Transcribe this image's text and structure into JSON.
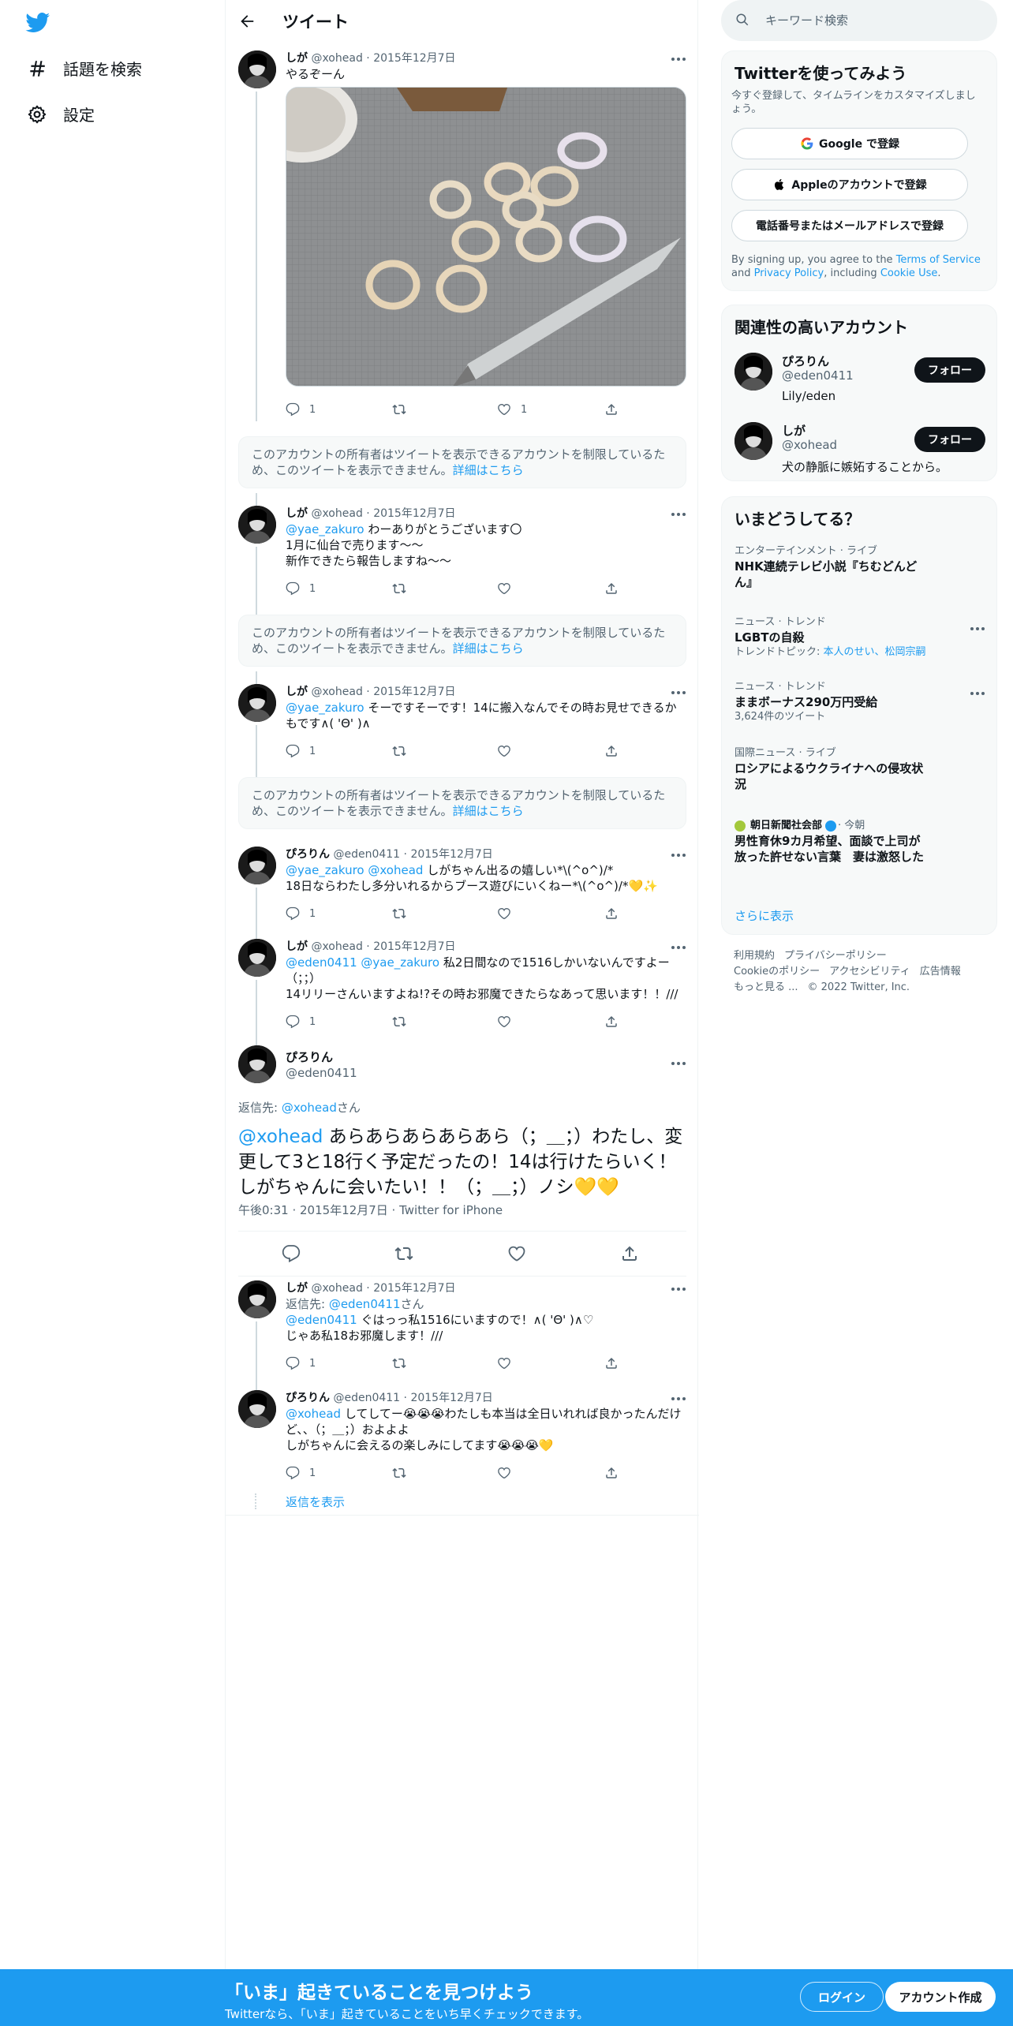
{
  "nav": {
    "search_label": "話題を検索",
    "settings_label": "設定"
  },
  "header": {
    "title": "ツイート"
  },
  "tweets": [
    {
      "name": "しが",
      "handle": "@xohead",
      "date": "2015年12月7日",
      "text": "やるぞーん",
      "replies": "1",
      "retweets": "",
      "likes": "1"
    },
    {
      "name": "しが",
      "handle": "@xohead",
      "date": "2015年12月7日",
      "mention": "@yae_zakuro",
      "text": " わーありがとうございます〇\n1月に仙台で売ります〜〜\n新作できたら報告しますね〜〜",
      "replies": "1",
      "retweets": "",
      "likes": ""
    },
    {
      "name": "しが",
      "handle": "@xohead",
      "date": "2015年12月7日",
      "mention": "@yae_zakuro",
      "text": " そーですそーです！14に搬入なんでその時お見せできるかもです∧( 'Θ' )∧",
      "replies": "1",
      "retweets": "",
      "likes": ""
    },
    {
      "name": "ぴろりん",
      "handle": "@eden0411",
      "date": "2015年12月7日",
      "mention": "@yae_zakuro @xohead",
      "text": " しがちゃん出るの嬉しい*\\(^o^)/*\n18日ならわたし多分いれるからブース遊びにいくねー*\\(^o^)/*💛✨",
      "replies": "1",
      "retweets": "",
      "likes": ""
    },
    {
      "name": "しが",
      "handle": "@xohead",
      "date": "2015年12月7日",
      "mention": "@eden0411 @yae_zakuro",
      "text": " 私2日間なので1516しかいないんですよー（；；）\n14リリーさんいますよね!?その時お邪魔できたらなあって思います！！///",
      "replies": "1",
      "retweets": "",
      "likes": ""
    },
    {
      "name": "しが",
      "handle": "@xohead",
      "date": "2015年12月7日",
      "reply_prefix": "返信先: ",
      "reply_to": "@eden0411",
      "reply_suffix": "さん",
      "mention": "@eden0411",
      "text": " ぐはっっ私1516にいますので！∧( 'Θ' )∧♡\nじゃあ私18お邪魔します！///",
      "replies": "1",
      "retweets": "",
      "likes": ""
    },
    {
      "name": "ぴろりん",
      "handle": "@eden0411",
      "date": "2015年12月7日",
      "mention": "@xohead",
      "text": " してしてー😭😭😭わたしも本当は全日いれれば良かったんだけど、、（；＿；）およよよ\nしがちゃんに会えるの楽しみにしてます😭😭😭💛",
      "replies": "1",
      "retweets": "",
      "likes": ""
    }
  ],
  "restricted": {
    "text": "このアカウントの所有者はツイートを表示できるアカウントを制限しているため、このツイートを表示できません。",
    "link": "詳細はこちら"
  },
  "main_tweet": {
    "name": "ぴろりん",
    "handle": "@eden0411",
    "reply_prefix": "返信先: ",
    "reply_to": "@xohead",
    "reply_suffix": "さん",
    "mention": "@xohead",
    "text": " あらあらあらあらあら（；＿；）わたし、変更して3と18行く予定だったの！14は行けたらいく！しがちゃんに会いたい！！（；＿；）ノシ💛💛",
    "timestamp": "午後0:31 · 2015年12月7日 · Twitter for iPhone"
  },
  "show_replies": "返信を表示",
  "search": {
    "placeholder": "キーワード検索"
  },
  "signup_card": {
    "title": "Twitterを使ってみよう",
    "subtitle": "今すぐ登録して、タイムラインをカスタマイズしましょう。",
    "google": "Google で登録",
    "apple": "Appleのアカウントで登録",
    "phone": "電話番号またはメールアドレスで登録",
    "legal_prefix": "By signing up, you agree to the ",
    "terms": "Terms of Service",
    "and": " and ",
    "privacy": "Privacy Policy",
    "including": ", including ",
    "cookie": "Cookie Use",
    "period": "."
  },
  "relevant": {
    "title": "関連性の高いアカウント",
    "follow_label": "フォロー",
    "accounts": [
      {
        "name": "ぴろりん",
        "handle": "@eden0411",
        "bio": "Lily/eden"
      },
      {
        "name": "しが",
        "handle": "@xohead",
        "bio": "犬の静脈に嫉妬することから。"
      }
    ]
  },
  "trends": {
    "title": "いまどうしてる？",
    "items": [
      {
        "category": "エンターテインメント · ライブ",
        "title": "NHK連続テレビ小説『ちむどんどん』"
      },
      {
        "category": "ニュース · トレンド",
        "title": "LGBTの自殺",
        "topic_prefix": "トレンドトピック: ",
        "topic_links": "本人のせい、松岡宗嗣"
      },
      {
        "category": "ニュース · トレンド",
        "title": "ままボーナス290万円受給",
        "count": "3,624件のツイート"
      },
      {
        "category": "国際ニュース · ライブ",
        "title": "ロシアによるウクライナへの侵攻状況"
      },
      {
        "source": "朝日新聞社会部",
        "time": " · 今朝",
        "title": "男性育休9カ月希望、面談で上司が放った許せない言葉　妻は激怒した"
      }
    ],
    "more": "さらに表示"
  },
  "footer": {
    "terms": "利用規約",
    "privacy": "プライバシーポリシー",
    "cookie": "Cookieのポリシー",
    "accessibility": "アクセシビリティ",
    "ads": "広告情報",
    "more": "もっと見る ...",
    "copyright": "© 2022 Twitter, Inc."
  },
  "bottom_bar": {
    "title": "「いま」起きていることを見つけよう",
    "subtitle": "Twitterなら、「いま」起きていることをいち早くチェックできます。",
    "login": "ログイン",
    "signup": "アカウント作成"
  },
  "colors": {
    "accent": "#1d9bf0",
    "text": "#0f1419",
    "muted": "#536471"
  }
}
